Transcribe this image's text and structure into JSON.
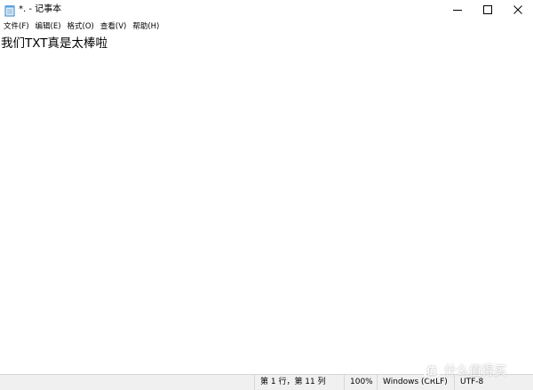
{
  "window": {
    "title": "*. - 记事本",
    "icon": "notepad-icon"
  },
  "title_buttons": {
    "minimize": "minimize-icon",
    "maximize": "maximize-icon",
    "close": "close-icon"
  },
  "menu": {
    "items": [
      {
        "label": "文件(F)"
      },
      {
        "label": "编辑(E)"
      },
      {
        "label": "格式(O)"
      },
      {
        "label": "查看(V)"
      },
      {
        "label": "帮助(H)"
      }
    ]
  },
  "editor": {
    "text": "我们TXT真是太棒啦"
  },
  "status": {
    "position": "第 1 行，第 11 列",
    "zoom": "100%",
    "line_ending": "Windows (CRLF)",
    "encoding": "UTF-8"
  },
  "watermark": {
    "text": "什么值得买",
    "logo": "smzdm-logo-icon"
  }
}
